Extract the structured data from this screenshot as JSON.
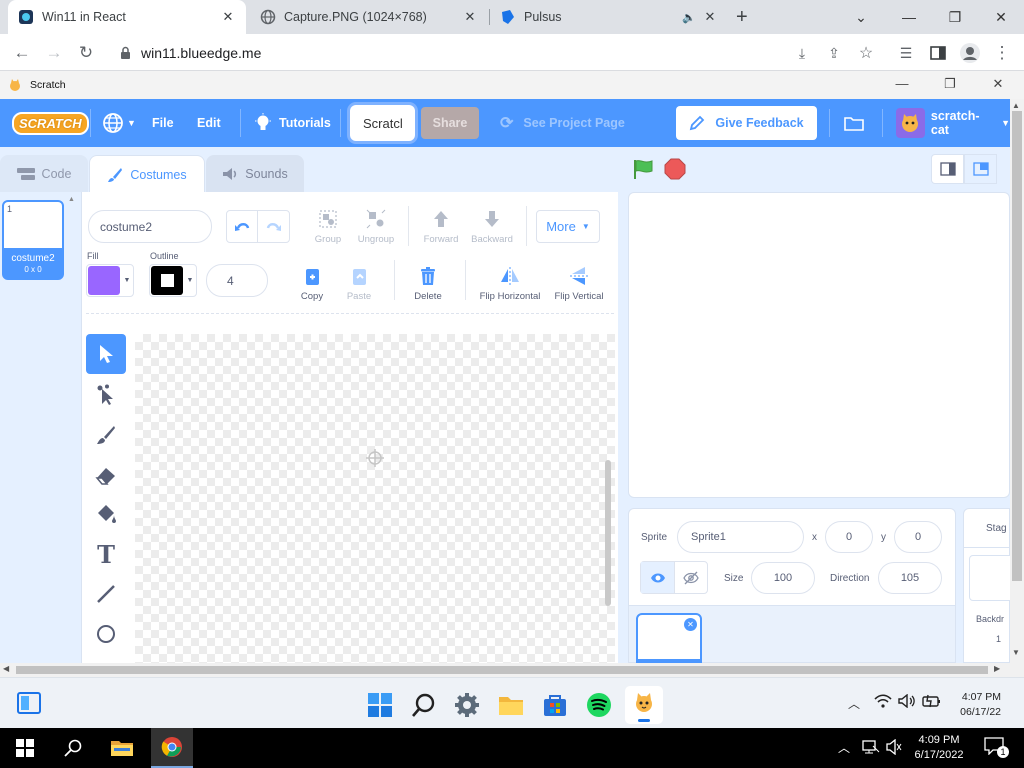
{
  "browser": {
    "tabs": [
      {
        "title": "Win11 in React",
        "active": true
      },
      {
        "title": "Capture.PNG (1024×768)",
        "active": false
      },
      {
        "title": "Pulsus",
        "active": false
      }
    ],
    "url": "win11.blueedge.me"
  },
  "window": {
    "title": "Scratch"
  },
  "menubar": {
    "logo": "SCRATCH",
    "file": "File",
    "edit": "Edit",
    "tutorials": "Tutorials",
    "project_title": "Scratcl",
    "share": "Share",
    "see_project_page": "See Project Page",
    "give_feedback": "Give Feedback",
    "username": "scratch-cat"
  },
  "editor_tabs": {
    "code": "Code",
    "costumes": "Costumes",
    "sounds": "Sounds"
  },
  "costume_list": [
    {
      "index": "1",
      "name": "costume2",
      "size": "0 x 0"
    }
  ],
  "paint": {
    "costume_name": "costume2",
    "fill_label": "Fill",
    "outline_label": "Outline",
    "outline_width": "4",
    "group": "Group",
    "ungroup": "Ungroup",
    "forward": "Forward",
    "backward": "Backward",
    "more": "More",
    "copy": "Copy",
    "paste": "Paste",
    "delete": "Delete",
    "flip_horizontal": "Flip Horizontal",
    "flip_vertical": "Flip Vertical",
    "fill_color": "#9966ff",
    "outline_color": "#000000"
  },
  "sprite_info": {
    "sprite_label": "Sprite",
    "sprite_name": "Sprite1",
    "x_label": "x",
    "x": "0",
    "y_label": "y",
    "y": "0",
    "size_label": "Size",
    "size": "100",
    "direction_label": "Direction",
    "direction": "105"
  },
  "stage_col": {
    "label": "Stag",
    "backdrops_label": "Backdr",
    "backdrops_count": "1"
  },
  "taskbar": {
    "time": "4:07 PM",
    "date": "06/17/22"
  },
  "host_taskbar": {
    "time": "4:09 PM",
    "date": "6/17/2022",
    "notifications": "1"
  },
  "colors": {
    "scratch_blue": "#4c97ff",
    "accent_purple": "#855cd6",
    "green_flag": "#4cbf56",
    "stop": "#ec5959"
  }
}
